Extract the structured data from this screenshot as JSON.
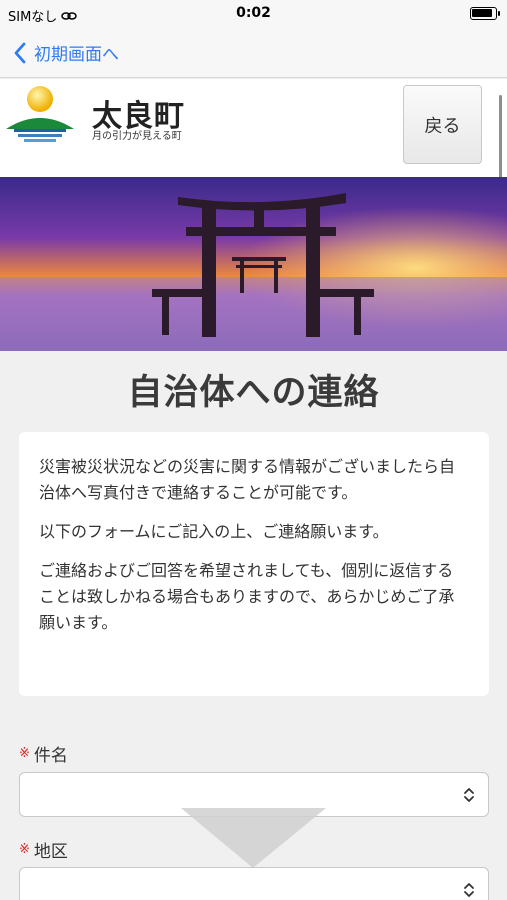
{
  "status_bar": {
    "carrier": "SIMなし",
    "time": "0:02",
    "battery_level": 0.9
  },
  "nav": {
    "back_label": "初期画面へ"
  },
  "header": {
    "town_name": "太良町",
    "tagline": "月の引力が見える町",
    "return_button": "戻る"
  },
  "page": {
    "title": "自治体への連絡",
    "notice": [
      "災害被災状況などの災害に関する情報がございましたら自治体へ写真付きで連絡することが可能です。",
      "以下のフォームにご記入の上、ご連絡願います。",
      "ご連絡およびご回答を希望されましても、個別に返信することは致しかねる場合もありますので、あらかじめご了承願います。"
    ]
  },
  "form": {
    "required_mark": "※",
    "subject": {
      "label": "件名",
      "value": ""
    },
    "district": {
      "label": "地区",
      "value": ""
    }
  },
  "colors": {
    "link": "#2f7bf6",
    "required": "#dd2222",
    "background": "#f0f0f0"
  }
}
